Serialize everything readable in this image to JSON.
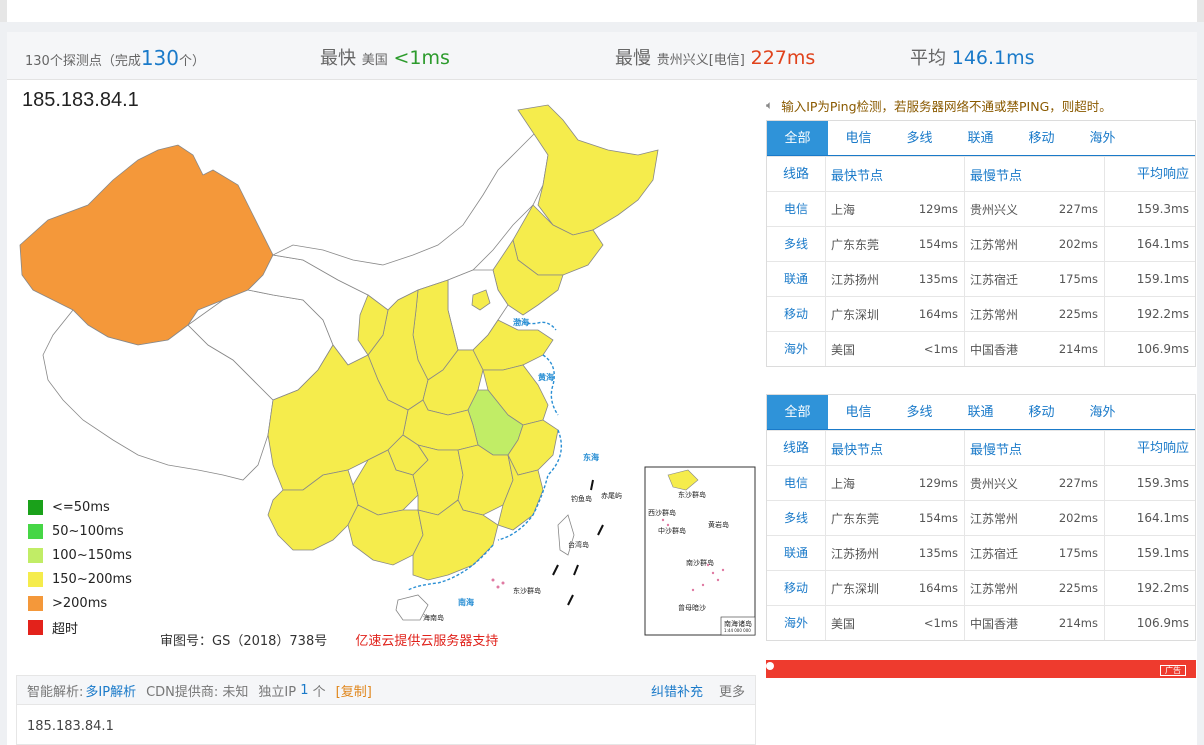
{
  "summary": {
    "count_prefix": "130个探测点（完成",
    "count_done": "130",
    "count_suffix": "个）",
    "fastest_label": "最快",
    "fastest_loc": "美国",
    "fastest_val": "<1ms",
    "slowest_label": "最慢",
    "slowest_loc": "贵州兴义[电信]",
    "slowest_val": "227ms",
    "avg_label": "平均",
    "avg_val": "146.1ms"
  },
  "ip": "185.183.84.1",
  "legend": [
    {
      "label": "<=50ms",
      "color": "#1aa11a"
    },
    {
      "label": "50~100ms",
      "color": "#46d646"
    },
    {
      "label": "100~150ms",
      "color": "#c1ed66"
    },
    {
      "label": "150~200ms",
      "color": "#f5ec4c"
    },
    {
      "label": ">200ms",
      "color": "#f4983a"
    },
    {
      "label": "超时",
      "color": "#e3221b"
    }
  ],
  "map": {
    "sea_labels": [
      "渤海",
      "黄海",
      "东海",
      "南海",
      "钓鱼岛",
      "赤尾屿",
      "台湾岛",
      "东沙群岛",
      "海南岛",
      "南海诸岛"
    ],
    "inset_labels": [
      "东沙群岛",
      "西沙群岛",
      "南沙群岛",
      "黄岩岛",
      "中沙群岛",
      "曾母暗沙",
      "南海诸岛"
    ],
    "scale": "1:44 000 000"
  },
  "footer": {
    "approval": "审图号：GS（2018）738号",
    "sponsor": "亿速云提供云服务器支持"
  },
  "notice": "输入IP为Ping检测，若服务器网络不通或禁PING，则超时。",
  "tables": [
    {
      "tabs": [
        "全部",
        "电信",
        "多线",
        "联通",
        "移动",
        "海外"
      ],
      "header": {
        "line": "线路",
        "fast": "最快节点",
        "slow": "最慢节点",
        "avg": "平均响应"
      },
      "rows": [
        {
          "line": "电信",
          "fast_loc": "上海",
          "fast_ms": "129ms",
          "slow_loc": "贵州兴义",
          "slow_ms": "227ms",
          "avg": "159.3ms"
        },
        {
          "line": "多线",
          "fast_loc": "广东东莞",
          "fast_ms": "154ms",
          "slow_loc": "江苏常州",
          "slow_ms": "202ms",
          "avg": "164.1ms"
        },
        {
          "line": "联通",
          "fast_loc": "江苏扬州",
          "fast_ms": "135ms",
          "slow_loc": "江苏宿迁",
          "slow_ms": "175ms",
          "avg": "159.1ms"
        },
        {
          "line": "移动",
          "fast_loc": "广东深圳",
          "fast_ms": "164ms",
          "slow_loc": "江苏常州",
          "slow_ms": "225ms",
          "avg": "192.2ms"
        },
        {
          "line": "海外",
          "fast_loc": "美国",
          "fast_ms": "<1ms",
          "slow_loc": "中国香港",
          "slow_ms": "214ms",
          "avg": "106.9ms"
        }
      ]
    },
    {
      "tabs": [
        "全部",
        "电信",
        "多线",
        "联通",
        "移动",
        "海外"
      ],
      "header": {
        "line": "线路",
        "fast": "最快节点",
        "slow": "最慢节点",
        "avg": "平均响应"
      },
      "rows": [
        {
          "line": "电信",
          "fast_loc": "上海",
          "fast_ms": "129ms",
          "slow_loc": "贵州兴义",
          "slow_ms": "227ms",
          "avg": "159.3ms"
        },
        {
          "line": "多线",
          "fast_loc": "广东东莞",
          "fast_ms": "154ms",
          "slow_loc": "江苏常州",
          "slow_ms": "202ms",
          "avg": "164.1ms"
        },
        {
          "line": "联通",
          "fast_loc": "江苏扬州",
          "fast_ms": "135ms",
          "slow_loc": "江苏宿迁",
          "slow_ms": "175ms",
          "avg": "159.1ms"
        },
        {
          "line": "移动",
          "fast_loc": "广东深圳",
          "fast_ms": "164ms",
          "slow_loc": "江苏常州",
          "slow_ms": "225ms",
          "avg": "192.2ms"
        },
        {
          "line": "海外",
          "fast_loc": "美国",
          "fast_ms": "<1ms",
          "slow_loc": "中国香港",
          "slow_ms": "214ms",
          "avg": "106.9ms"
        }
      ]
    }
  ],
  "ad": {
    "tag": "广告"
  },
  "dns": {
    "resolve_label": "智能解析:",
    "resolve_link": "多IP解析",
    "cdn_label": "CDN提供商: 未知",
    "ip_label": "独立IP",
    "ip_count": "1",
    "ip_unit": "个",
    "copy": "[复制]",
    "correct": "纠错补充",
    "more": "更多",
    "body_ip": "185.183.84.1"
  }
}
